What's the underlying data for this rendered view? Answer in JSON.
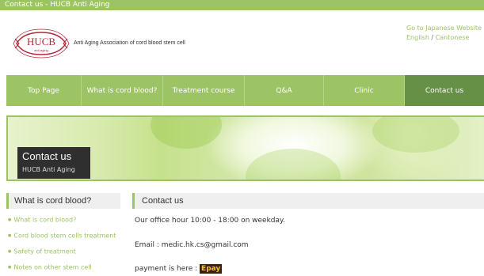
{
  "window": {
    "title": "Contact us - HUCB Anti Aging"
  },
  "header": {
    "logo_text": "HUCB",
    "logo_subtext": "anti-aging",
    "tagline": "Anti Aging Association of cord blood stem cell",
    "lang_japanese": "Go to Japanese Website",
    "lang_english": "English",
    "lang_separator": " / ",
    "lang_cantonese": "Cantonese"
  },
  "nav": {
    "items": [
      {
        "label": "Top Page"
      },
      {
        "label": "What is cord blood?"
      },
      {
        "label": "Treatment course"
      },
      {
        "label": "Q&A"
      },
      {
        "label": "Clinic"
      },
      {
        "label": "Contact us"
      }
    ],
    "active_index": 5
  },
  "banner": {
    "title": "Contact us",
    "subtitle": "HUCB Anti Aging"
  },
  "sidebar": {
    "heading": "What is cord blood?",
    "items": [
      {
        "label": "What is cord blood?"
      },
      {
        "label": "Cord blood stem cells treatment"
      },
      {
        "label": "Safety of treatment"
      },
      {
        "label": "Notes on other stem cell"
      }
    ]
  },
  "main": {
    "heading": "Contact us",
    "office_hour": "Our office hour 10:00 - 18:00 on weekday.",
    "email": "Email : medic.hk.cs@gmail.com",
    "payment_text": "payment is here : ",
    "epay_label": "Epay"
  },
  "colors": {
    "accent": "#9cc465",
    "nav_active": "#679047",
    "logo_red": "#b5273a"
  }
}
